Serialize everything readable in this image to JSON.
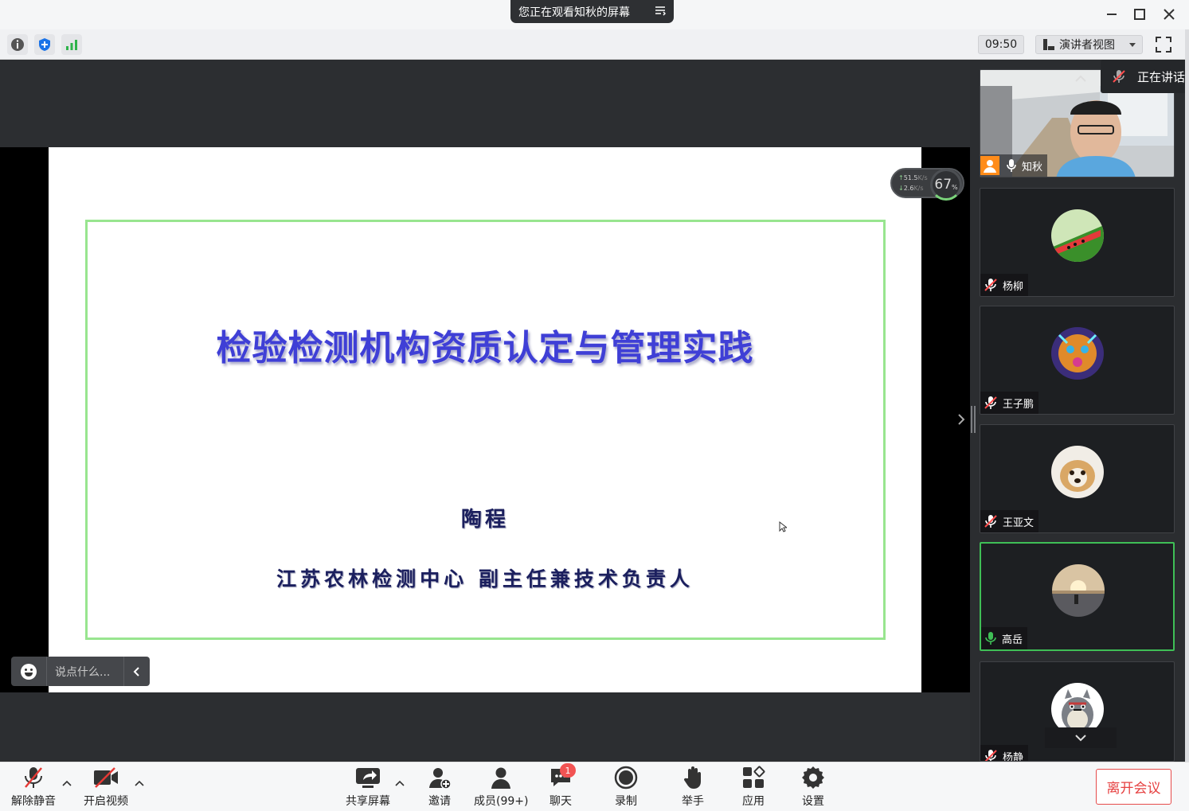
{
  "titlebar": {
    "share_notice": "您正在观看知秋的屏幕"
  },
  "topbar": {
    "time": "09:50",
    "view_mode": "演讲者视图"
  },
  "slide": {
    "title": "检验检测机构资质认定与管理实践",
    "author": "陶程",
    "organization": "江苏农林检测中心  副主任兼技术负责人"
  },
  "net_widget": {
    "upload": "51.5",
    "upload_unit": "K/s",
    "download": "2.6",
    "download_unit": "K/s",
    "percent": "67",
    "percent_unit": "%"
  },
  "chat_input": {
    "placeholder": "说点什么..."
  },
  "gallery": {
    "speaking_label": "正在讲话",
    "participants": [
      {
        "name": "知秋",
        "muted": false,
        "video": true
      },
      {
        "name": "杨柳",
        "muted": true
      },
      {
        "name": "王子鹏",
        "muted": true
      },
      {
        "name": "王亚文",
        "muted": true
      },
      {
        "name": "高岳",
        "muted": false,
        "active": true
      },
      {
        "name": "杨静",
        "muted": true
      }
    ]
  },
  "bottombar": {
    "unmute": "解除静音",
    "start_video": "开启视频",
    "share_screen": "共享屏幕",
    "invite": "邀请",
    "members": "成员(99+)",
    "chat": "聊天",
    "chat_badge": "1",
    "record": "录制",
    "raise_hand": "举手",
    "apps": "应用",
    "settings": "设置",
    "leave": "离开会议"
  },
  "colors": {
    "slide_title": "#3f3fd6",
    "frame": "#98e58f",
    "leave": "#e64040",
    "active_tile": "#3fbf56"
  }
}
